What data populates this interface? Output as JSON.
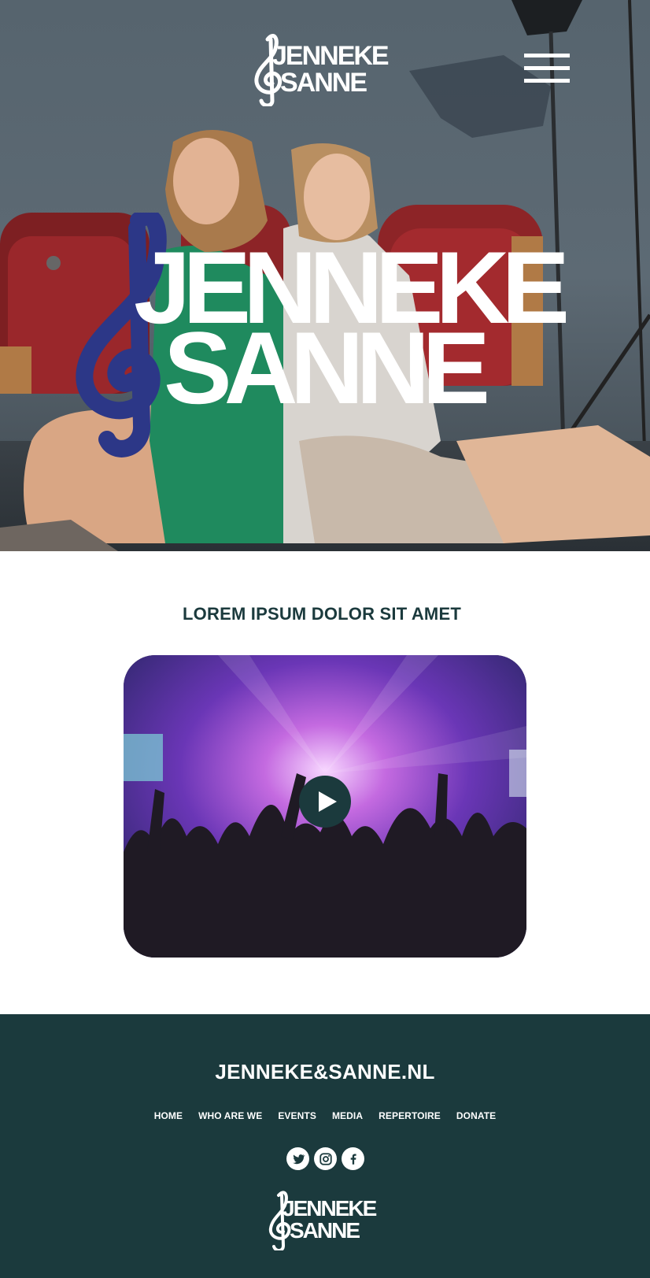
{
  "brand": {
    "logo_line1": "JENNEKE",
    "logo_line2": "SANNE",
    "logo_color": "#ffffff",
    "clef_color": "#2c3787"
  },
  "header": {
    "menu_icon": "hamburger-icon"
  },
  "main": {
    "heading": "LOREM IPSUM DOLOR SIT AMET",
    "video": {
      "play_icon": "play-icon"
    }
  },
  "footer": {
    "domain": "JENNEKE&SANNE.NL",
    "nav": [
      "HOME",
      "WHO ARE WE",
      "EVENTS",
      "MEDIA",
      "REPERTOIRE",
      "DONATE"
    ],
    "socials": [
      "twitter-icon",
      "instagram-icon",
      "facebook-icon"
    ],
    "background": "#1b3a3d"
  },
  "colors": {
    "accent_dark": "#1b3a3d",
    "clef_blue": "#2c3787"
  }
}
